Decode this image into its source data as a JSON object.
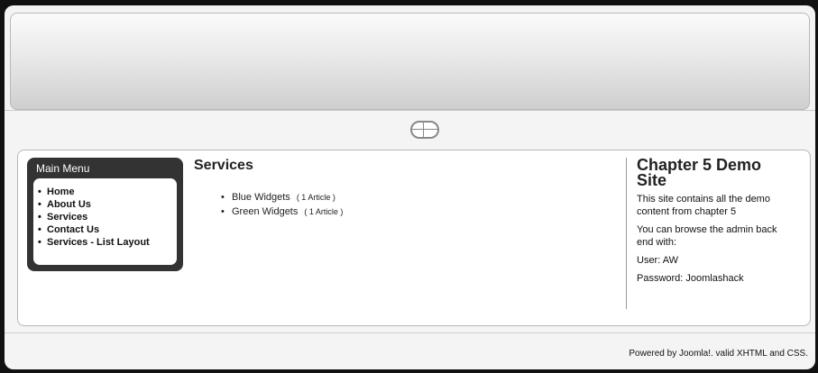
{
  "main_menu": {
    "title": "Main Menu",
    "items": [
      "Home",
      "About Us",
      "Services",
      "Contact Us",
      "Services - List Layout"
    ]
  },
  "services": {
    "title": "Services",
    "articles": [
      {
        "label": "Blue Widgets",
        "count": "( 1 Article )"
      },
      {
        "label": "Green Widgets",
        "count": "( 1 Article )"
      }
    ]
  },
  "sidebar": {
    "title": "Chapter 5 Demo Site",
    "paragraphs": [
      "This site contains all the demo content from chapter 5",
      "You can browse the admin back end with:",
      "User: AW",
      "Password: Joomlashack"
    ]
  },
  "footer": {
    "powered_by": "Powered by Joomla!. valid XHTML and CSS."
  }
}
